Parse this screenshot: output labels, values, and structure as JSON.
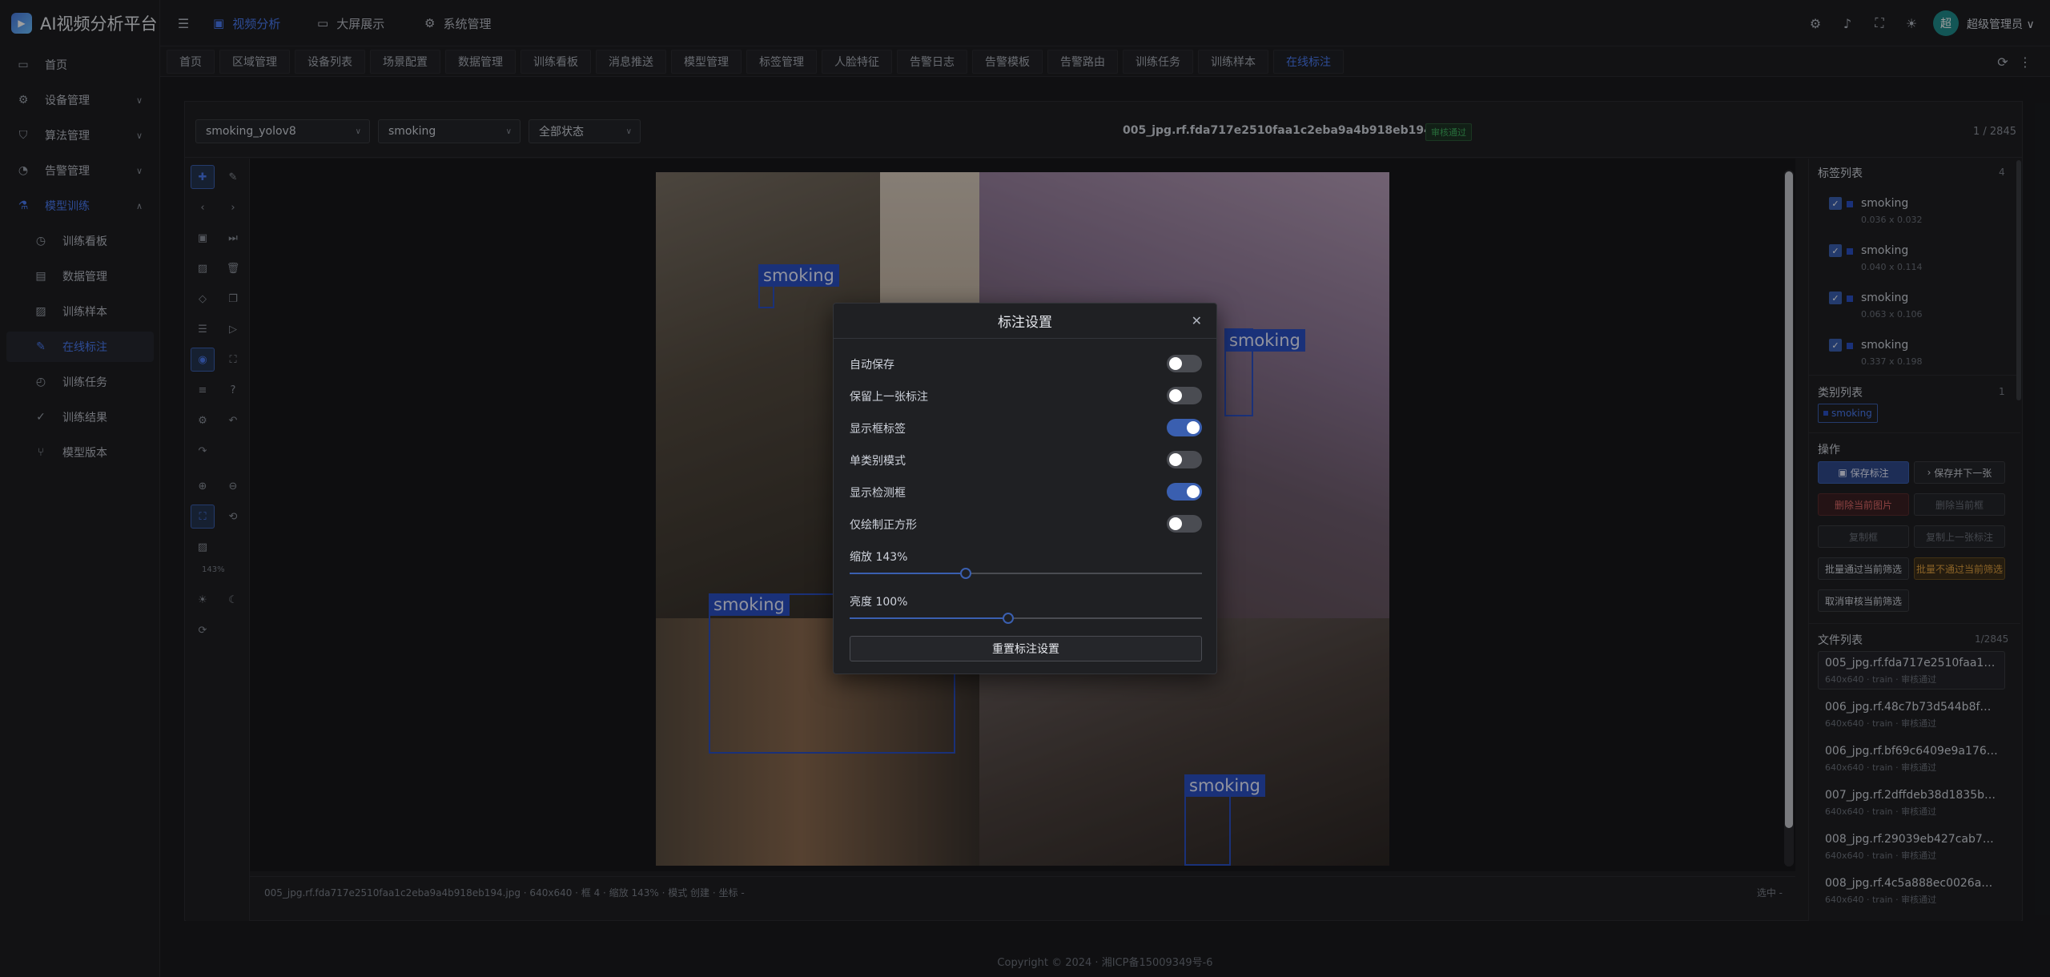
{
  "app": {
    "title": "AI视频分析平台"
  },
  "sidebar": {
    "items": [
      {
        "label": "首页",
        "icon": "monitor-icon"
      },
      {
        "label": "设备管理",
        "icon": "gear-icon"
      },
      {
        "label": "算法管理",
        "icon": "shield-icon"
      },
      {
        "label": "告警管理",
        "icon": "alert-icon"
      },
      {
        "label": "模型训练",
        "icon": "flask-icon"
      }
    ],
    "sub_items": [
      {
        "label": "训练看板",
        "icon": "dashboard-icon"
      },
      {
        "label": "数据管理",
        "icon": "database-icon"
      },
      {
        "label": "训练样本",
        "icon": "image-icon"
      },
      {
        "label": "在线标注",
        "icon": "edit-icon"
      },
      {
        "label": "训练任务",
        "icon": "clock-icon"
      },
      {
        "label": "训练结果",
        "icon": "check-circle-icon"
      },
      {
        "label": "模型版本",
        "icon": "branch-icon"
      }
    ]
  },
  "topbar": {
    "menus": [
      {
        "label": "视频分析",
        "icon": "video-icon"
      },
      {
        "label": "大屏展示",
        "icon": "monitor-icon"
      },
      {
        "label": "系统管理",
        "icon": "gear-icon"
      }
    ],
    "avatar_text": "超",
    "username": "超级管理员"
  },
  "tabs": [
    "首页",
    "区域管理",
    "设备列表",
    "场景配置",
    "数据管理",
    "训练看板",
    "消息推送",
    "模型管理",
    "标签管理",
    "人脸特征",
    "告警日志",
    "告警模板",
    "告警路由",
    "训练任务",
    "训练样本",
    "在线标注"
  ],
  "filters": {
    "model": "smoking_yolov8",
    "label": "smoking",
    "status": "全部状态"
  },
  "header": {
    "filename": "005_jpg.rf.fda717e2510faa1c2eba9a4b918eb194.jpg",
    "badge": "审核通过",
    "pager": "1 / 2845"
  },
  "canvas": {
    "zoom_label": "143%",
    "box_labels": [
      "smoking",
      "smoking",
      "smoking",
      "smoking"
    ]
  },
  "statusbar": {
    "text": "005_jpg.rf.fda717e2510faa1c2eba9a4b918eb194.jpg · 640x640 · 框 4 · 缩放 143% · 模式 创建 · 坐标 -",
    "right": "选中 -"
  },
  "right_panel": {
    "labels_title": "标签列表",
    "labels_count": "4",
    "labels": [
      {
        "name": "smoking",
        "size": "0.036 x 0.032"
      },
      {
        "name": "smoking",
        "size": "0.040 x 0.114"
      },
      {
        "name": "smoking",
        "size": "0.063 x 0.106"
      },
      {
        "name": "smoking",
        "size": "0.337 x 0.198"
      }
    ],
    "classes_title": "类别列表",
    "classes_count": "1",
    "class_tag": "smoking",
    "ops_title": "操作",
    "ops": {
      "save": "保存标注",
      "save_next": "保存并下一张",
      "delete_image": "删除当前图片",
      "delete_box": "删除当前框",
      "copy_box": "复制框",
      "copy_prev": "复制上一张标注",
      "batch_pass": "批量通过当前筛选",
      "batch_reject": "批量不通过当前筛选",
      "cancel_review": "取消审核当前筛选"
    },
    "files_title": "文件列表",
    "files_count": "1/2845",
    "files": [
      {
        "name": "005_jpg.rf.fda717e2510faa1c2e...",
        "meta": "640x640 · train · 审核通过"
      },
      {
        "name": "006_jpg.rf.48c7b73d544b8f8c...",
        "meta": "640x640 · train · 审核通过"
      },
      {
        "name": "006_jpg.rf.bf69c6409e9a176fa...",
        "meta": "640x640 · train · 审核通过"
      },
      {
        "name": "007_jpg.rf.2dffdeb38d1835b08...",
        "meta": "640x640 · train · 审核通过"
      },
      {
        "name": "008_jpg.rf.29039eb427cab733...",
        "meta": "640x640 · train · 审核通过"
      },
      {
        "name": "008_jpg.rf.4c5a888ec0026a5e...",
        "meta": "640x640 · train · 审核通过"
      }
    ]
  },
  "footer": {
    "text": "Copyright © 2024 · 湘ICP备15009349号-6"
  },
  "modal": {
    "title": "标注设置",
    "toggles": [
      {
        "label": "自动保存",
        "on": false
      },
      {
        "label": "保留上一张标注",
        "on": false
      },
      {
        "label": "显示框标签",
        "on": true
      },
      {
        "label": "单类别模式",
        "on": false
      },
      {
        "label": "显示检测框",
        "on": true
      },
      {
        "label": "仅绘制正方形",
        "on": false
      }
    ],
    "zoom_label": "缩放 143%",
    "zoom_value": 0.33,
    "brightness_label": "亮度 100%",
    "brightness_value": 0.45,
    "reset_label": "重置标注设置"
  },
  "colors": {
    "accent": "#4a7af0",
    "box": "#2b4fc4"
  }
}
